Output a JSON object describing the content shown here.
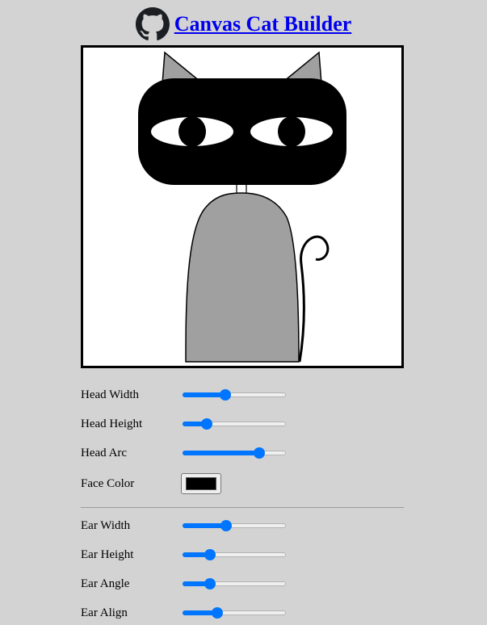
{
  "header": {
    "title": "Canvas Cat Builder",
    "icon": "github-icon"
  },
  "canvas": {
    "background": "#ffffff",
    "face_color": "#000000",
    "ear_color": "#a0a0a0",
    "body_color": "#a0a0a0",
    "eye_color": "#ffffff",
    "pupil_color": "#000000"
  },
  "controls": {
    "head_width": {
      "label": "Head Width",
      "value_fraction": 0.4
    },
    "head_height": {
      "label": "Head Height",
      "value_fraction": 0.2
    },
    "head_arc": {
      "label": "Head Arc",
      "value_fraction": 0.77
    },
    "face_color": {
      "label": "Face Color",
      "value": "#000000"
    },
    "ear_width": {
      "label": "Ear Width",
      "value_fraction": 0.41
    },
    "ear_height": {
      "label": "Ear Height",
      "value_fraction": 0.24
    },
    "ear_angle": {
      "label": "Ear Angle",
      "value_fraction": 0.24
    },
    "ear_align": {
      "label": "Ear Align",
      "value_fraction": 0.32
    }
  }
}
